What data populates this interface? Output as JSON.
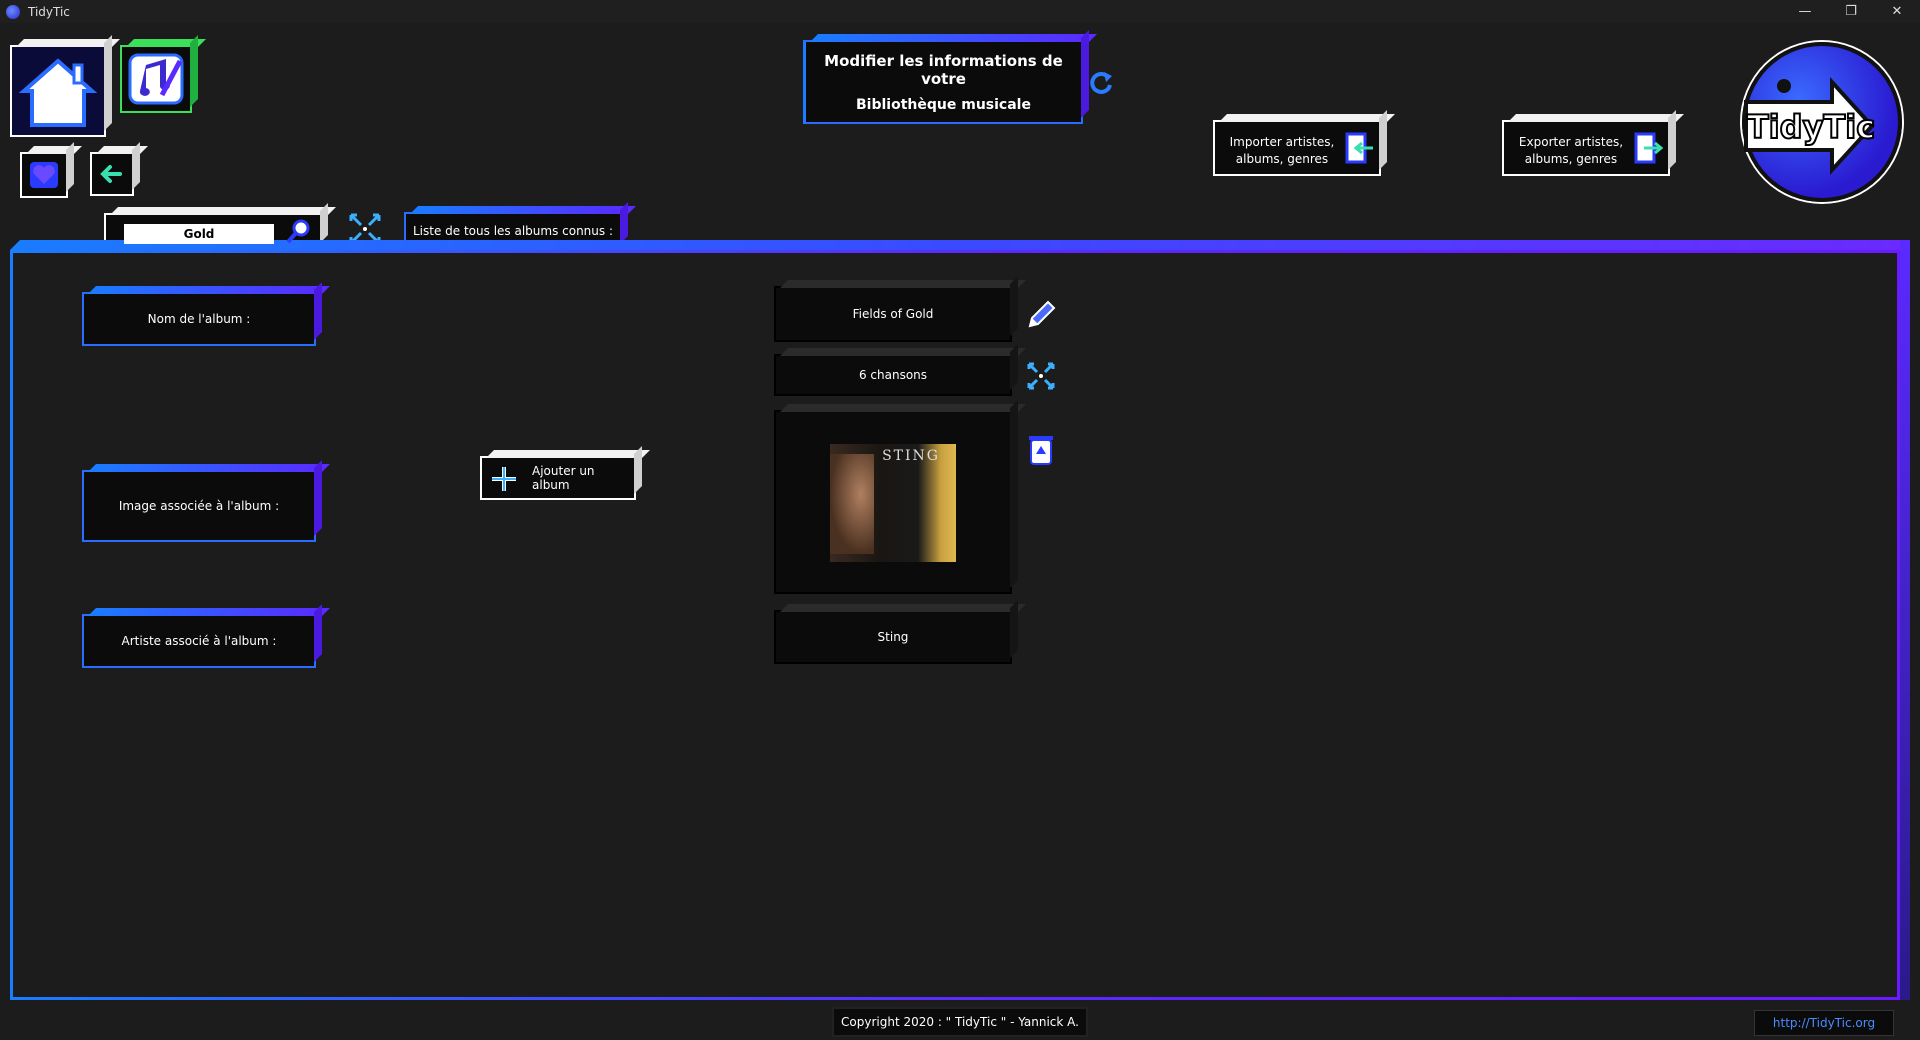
{
  "window": {
    "title": "TidyTic",
    "minimize": "—",
    "restore": "❐",
    "close": "✕"
  },
  "header": {
    "title_line1": "Modifier les informations de votre",
    "title_line2": "Bibliothèque musicale",
    "import_label_1": "Importer artistes,",
    "import_label_2": "albums, genres",
    "export_label_1": "Exporter artistes,",
    "export_label_2": "albums, genres",
    "logo_text": "TidyTic"
  },
  "search": {
    "value": "Gold"
  },
  "tab": {
    "label": "Liste de tous les albums connus :"
  },
  "form": {
    "album_name_label": "Nom de l'album :",
    "album_image_label": "Image associée à l'album :",
    "album_artist_label": "Artiste associé à l'album :",
    "add_album_label": "Ajouter un album"
  },
  "album": {
    "name": "Fields of Gold",
    "songs": "6 chansons",
    "artist": "Sting",
    "cover_text": "STING"
  },
  "footer": {
    "copyright": "Copyright 2020 : \" TidyTic \" - Yannick A.",
    "link": "http://TidyTic.org"
  },
  "colors": {
    "accent_blue": "#1a7cff",
    "accent_purple": "#5a2aff",
    "background": "#1c1c1c"
  }
}
